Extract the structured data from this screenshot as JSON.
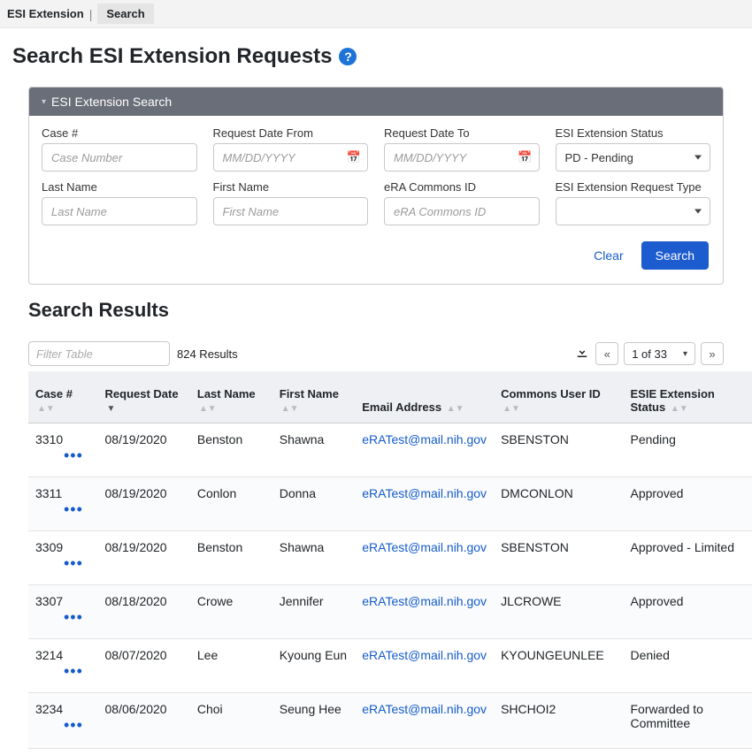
{
  "topbar": {
    "app_label": "ESI Extension",
    "search_tab": "Search"
  },
  "page_title": "Search ESI Extension Requests",
  "panel_header": "ESI Extension Search",
  "form": {
    "case": {
      "label": "Case #",
      "placeholder": "Case Number"
    },
    "date_from": {
      "label": "Request Date From",
      "placeholder": "MM/DD/YYYY"
    },
    "date_to": {
      "label": "Request Date To",
      "placeholder": "MM/DD/YYYY"
    },
    "status": {
      "label": "ESI Extension Status",
      "selected": "PD - Pending"
    },
    "last_name": {
      "label": "Last Name",
      "placeholder": "Last Name"
    },
    "first_name": {
      "label": "First Name",
      "placeholder": "First Name"
    },
    "commons_id": {
      "label": "eRA Commons ID",
      "placeholder": "eRA Commons ID"
    },
    "request_type": {
      "label": "ESI Extension Request Type",
      "selected": ""
    }
  },
  "buttons": {
    "clear": "Clear",
    "search": "Search"
  },
  "results": {
    "title": "Search Results",
    "filter_placeholder": "Filter Table",
    "count": "824 Results",
    "page_of": "1 of 33",
    "columns": {
      "case": "Case #",
      "request_date": "Request Date",
      "last_name": "Last Name",
      "first_name": "First Name",
      "email": "Email Address",
      "commons_id": "Commons User ID",
      "status": "ESIE Extension Status"
    },
    "rows": [
      {
        "case": "3310",
        "date": "08/19/2020",
        "last": "Benston",
        "first": "Shawna",
        "email": "eRATest@mail.nih.gov",
        "commons": "SBENSTON",
        "status": "Pending"
      },
      {
        "case": "3311",
        "date": "08/19/2020",
        "last": "Conlon",
        "first": "Donna",
        "email": "eRATest@mail.nih.gov",
        "commons": "DMCONLON",
        "status": "Approved"
      },
      {
        "case": "3309",
        "date": "08/19/2020",
        "last": "Benston",
        "first": "Shawna",
        "email": "eRATest@mail.nih.gov",
        "commons": "SBENSTON",
        "status": "Approved - Limited"
      },
      {
        "case": "3307",
        "date": "08/18/2020",
        "last": "Crowe",
        "first": "Jennifer",
        "email": "eRATest@mail.nih.gov",
        "commons": "JLCROWE",
        "status": "Approved"
      },
      {
        "case": "3214",
        "date": "08/07/2020",
        "last": "Lee",
        "first": "Kyoung Eun",
        "email": "eRATest@mail.nih.gov",
        "commons": "KYOUNGEUNLEE",
        "status": "Denied"
      },
      {
        "case": "3234",
        "date": "08/06/2020",
        "last": "Choi",
        "first": "Seung Hee",
        "email": "eRATest@mail.nih.gov",
        "commons": "SHCHOI2",
        "status": "Forwarded to Committee"
      }
    ]
  }
}
